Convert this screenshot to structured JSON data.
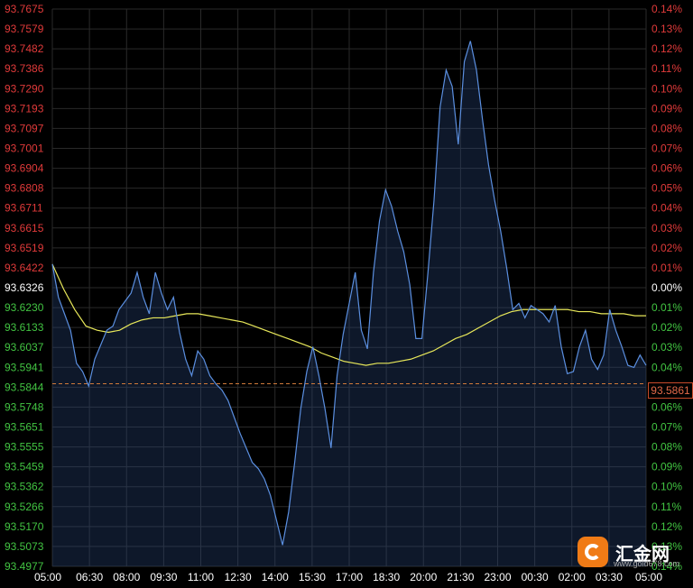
{
  "colors": {
    "background": "#000000",
    "grid": "#2a2a2a",
    "up_label": "#e03a3a",
    "down_label": "#42c442",
    "price_line": "#5b8fe0",
    "average_line": "#e8e85a",
    "reference_line": "#d07a3a",
    "axis_label": "#ffffff"
  },
  "watermark": {
    "brand": "汇金网",
    "domain": "www.gold678.com"
  },
  "chart_data": {
    "type": "line",
    "reference_price": 93.6326,
    "current_price": 93.5861,
    "current_price_label": "93.5861",
    "ylim": [
      93.4977,
      93.7675
    ],
    "left_ticks": [
      "93.7675",
      "93.7579",
      "93.7482",
      "93.7386",
      "93.7290",
      "93.7193",
      "93.7097",
      "93.7001",
      "93.6904",
      "93.6808",
      "93.6711",
      "93.6615",
      "93.6519",
      "93.6422",
      "93.6326",
      "93.6230",
      "93.6133",
      "93.6037",
      "93.5941",
      "93.5844",
      "93.5748",
      "93.5651",
      "93.5555",
      "93.5459",
      "93.5362",
      "93.5266",
      "93.5170",
      "93.5073",
      "93.4977"
    ],
    "right_ticks": [
      "0.14%",
      "0.13%",
      "0.12%",
      "0.11%",
      "0.10%",
      "0.09%",
      "0.08%",
      "0.07%",
      "0.06%",
      "0.05%",
      "0.04%",
      "0.03%",
      "0.02%",
      "0.01%",
      "0.00%",
      "0.01%",
      "0.02%",
      "0.03%",
      "0.04%",
      "0.05%",
      "0.06%",
      "0.07%",
      "0.08%",
      "0.09%",
      "0.10%",
      "0.11%",
      "0.12%",
      "0.13%",
      "0.14%"
    ],
    "x_ticks": [
      "05:00",
      "06:30",
      "08:00",
      "09:30",
      "11:00",
      "12:30",
      "14:00",
      "15:30",
      "17:00",
      "18:30",
      "20:00",
      "21:30",
      "23:00",
      "00:30",
      "02:00",
      "03:30",
      "05:00"
    ],
    "series": [
      {
        "values": [
          93.644,
          93.628,
          93.62,
          93.612,
          93.596,
          93.592,
          93.585,
          93.598,
          93.605,
          93.612,
          93.614,
          93.622,
          93.626,
          93.63,
          93.64,
          93.628,
          93.62,
          93.64,
          93.63,
          93.622,
          93.628,
          93.611,
          93.598,
          93.59,
          93.602,
          93.598,
          93.59,
          93.586,
          93.583,
          93.578,
          93.57,
          93.562,
          93.555,
          93.548,
          93.545,
          93.54,
          93.532,
          93.52,
          93.508,
          93.524,
          93.548,
          93.574,
          93.592,
          93.604,
          93.59,
          93.574,
          93.555,
          93.59,
          93.61,
          93.625,
          93.64,
          93.612,
          93.603,
          93.64,
          93.665,
          93.68,
          93.672,
          93.66,
          93.65,
          93.634,
          93.608,
          93.608,
          93.64,
          93.675,
          93.72,
          93.738,
          93.73,
          93.702,
          93.742,
          93.752,
          93.738,
          93.714,
          93.692,
          93.675,
          93.66,
          93.642,
          93.622,
          93.625,
          93.618,
          93.624,
          93.622,
          93.62,
          93.616,
          93.624,
          93.604,
          93.591,
          93.592,
          93.604,
          93.612,
          93.598,
          93.593,
          93.6,
          93.622,
          93.612,
          93.604,
          93.595,
          93.594,
          93.6,
          93.595
        ]
      },
      {
        "values": [
          93.644,
          93.632,
          93.622,
          93.614,
          93.612,
          93.611,
          93.612,
          93.615,
          93.617,
          93.618,
          93.618,
          93.619,
          93.62,
          93.62,
          93.619,
          93.618,
          93.617,
          93.616,
          93.614,
          93.612,
          93.61,
          93.608,
          93.606,
          93.604,
          93.601,
          93.599,
          93.597,
          93.596,
          93.595,
          93.596,
          93.596,
          93.597,
          93.598,
          93.6,
          93.602,
          93.605,
          93.608,
          93.61,
          93.613,
          93.616,
          93.619,
          93.621,
          93.622,
          93.622,
          93.622,
          93.622,
          93.622,
          93.621,
          93.621,
          93.62,
          93.62,
          93.62,
          93.619,
          93.619
        ]
      }
    ]
  }
}
